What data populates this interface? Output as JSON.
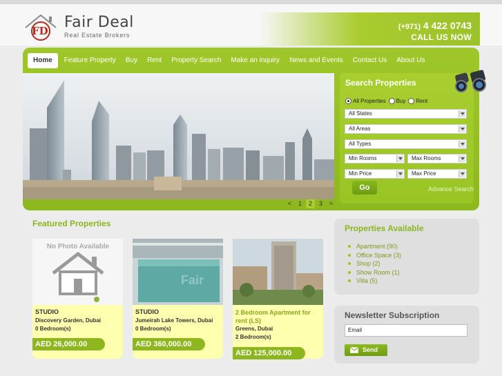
{
  "brand": {
    "name": "Fair Deal",
    "tagline": "Real Estate Brokers",
    "logo_letters": "FD",
    "logo_ring_text": "Real Estate Brokers",
    "accent": "#9cc22a"
  },
  "contact": {
    "phone_code": "(+971)",
    "phone_number": "4 422 0743",
    "call_label": "CALL US NOW"
  },
  "nav": {
    "items": [
      {
        "label": "Home"
      },
      {
        "label": "Feature Property"
      },
      {
        "label": "Buy"
      },
      {
        "label": "Rent"
      },
      {
        "label": "Property Search"
      },
      {
        "label": "Make an inquiry"
      },
      {
        "label": "News and Events"
      },
      {
        "label": "Contact Us"
      },
      {
        "label": "About Us"
      }
    ]
  },
  "slider": {
    "prev": "<",
    "pages": [
      "1",
      "2",
      "3"
    ],
    "current_page": "2",
    "next": ">"
  },
  "search": {
    "title": "Search Properties",
    "radios": [
      {
        "label": "All Properties",
        "checked": true
      },
      {
        "label": "Buy",
        "checked": false
      },
      {
        "label": "Rent",
        "checked": false
      }
    ],
    "states": "All States",
    "areas": "All Areas",
    "types": "All Types",
    "min_rooms": "Min Rooms",
    "max_rooms": "Max Rooms",
    "min_price": "Min Price",
    "max_price": "Max Price",
    "go": "Go",
    "advance": "Advance Search"
  },
  "featured": {
    "title": "Featured Properties",
    "no_photo_text": "No Photo Available",
    "cards": [
      {
        "type": "STUDIO",
        "location": "Discovery Garden, Dubai",
        "bedrooms": "0 Bedroom(s)",
        "price": "AED 26,000.00"
      },
      {
        "type": "STUDIO",
        "location": "Jumeirah Lake Towers, Dubai",
        "bedrooms": "0 Bedroom(s)",
        "price": "AED 360,000.00"
      },
      {
        "title_line1": "2 Bedroom Apartment for",
        "title_line2": "rent (LS)",
        "location": "Greens, Dubai",
        "bedrooms": "2 Bedroom(s)",
        "price": "AED 125,000.00"
      }
    ]
  },
  "available": {
    "title": "Properties Available",
    "items": [
      "Apartment (90)",
      "Office Space (3)",
      "Shop (2)",
      "Show Room (1)",
      "Villa (5)"
    ]
  },
  "newsletter": {
    "title": "Newsletter Subscription",
    "email_value": "Email",
    "send": "Send"
  }
}
